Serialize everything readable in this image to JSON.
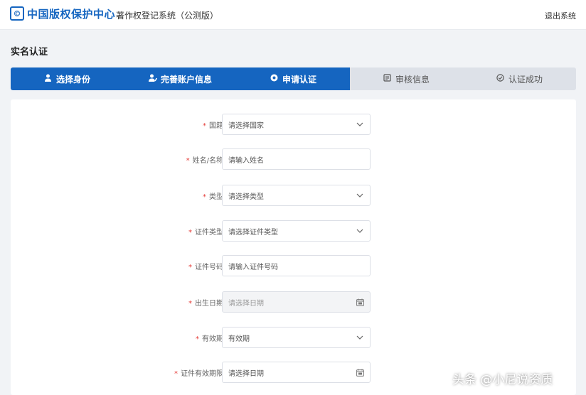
{
  "header": {
    "logo_text": "中国版权保护中心",
    "system_title": "著作权登记系统（公测版）",
    "logout_label": "退出系统"
  },
  "page_title": "实名认证",
  "steps": [
    {
      "label": "选择身份",
      "icon": "user-icon",
      "state": "active"
    },
    {
      "label": "完善账户信息",
      "icon": "user-edit-icon",
      "state": "active"
    },
    {
      "label": "申请认证",
      "icon": "check-circle-icon",
      "state": "active"
    },
    {
      "label": "审核信息",
      "icon": "audit-icon",
      "state": "inactive"
    },
    {
      "label": "认证成功",
      "icon": "success-icon",
      "state": "inactive"
    }
  ],
  "form": {
    "fields": [
      {
        "label": "国籍",
        "required": true,
        "type": "select",
        "value": "请选择国家"
      },
      {
        "label": "姓名/名称",
        "required": true,
        "type": "input",
        "placeholder": "请输入姓名"
      },
      {
        "label": "类型",
        "required": true,
        "type": "select",
        "value": "请选择类型"
      },
      {
        "label": "证件类型",
        "required": true,
        "type": "select",
        "value": "请选择证件类型"
      },
      {
        "label": "证件号码",
        "required": true,
        "type": "input",
        "placeholder": "请输入证件号码"
      },
      {
        "label": "出生日期",
        "required": true,
        "type": "date",
        "value": "请选择日期",
        "disabled": true
      },
      {
        "label": "有效期",
        "required": true,
        "type": "select",
        "value": "有效期"
      },
      {
        "label": "证件有效期限",
        "required": true,
        "type": "date",
        "value": "请选择日期"
      }
    ]
  },
  "watermark": "头条 @小尼说资质",
  "colors": {
    "primary": "#1565c0",
    "step_inactive": "#dde1e8",
    "required": "#e53935"
  }
}
